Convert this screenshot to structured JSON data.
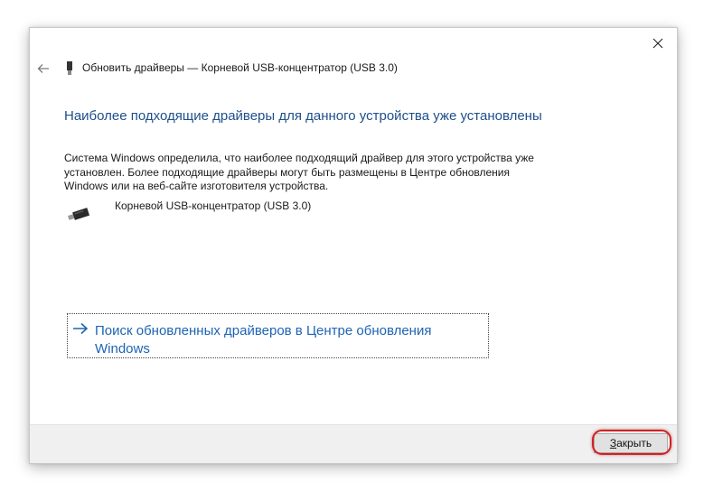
{
  "window": {
    "title": "Обновить драйверы — Корневой USB-концентратор (USB 3.0)"
  },
  "content": {
    "heading": "Наиболее подходящие драйверы для данного устройства уже установлены",
    "description": "Система Windows определила, что наиболее подходящий драйвер для этого устройства уже установлен. Более подходящие драйверы могут быть размещены в Центре обновления Windows или на веб-сайте изготовителя устройства.",
    "device_name": "Корневой USB-концентратор (USB 3.0)",
    "link_text": "Поиск обновленных драйверов в Центре обновления Windows"
  },
  "footer": {
    "close_label_accesskey": "З",
    "close_label_rest": "акрыть"
  },
  "icons": {
    "close": "close-icon",
    "back": "back-arrow-icon",
    "device": "usb-device-icon",
    "link": "arrow-right-icon"
  },
  "colors": {
    "heading": "#1e4f8c",
    "link": "#1e64b4",
    "highlight": "#d42020"
  }
}
